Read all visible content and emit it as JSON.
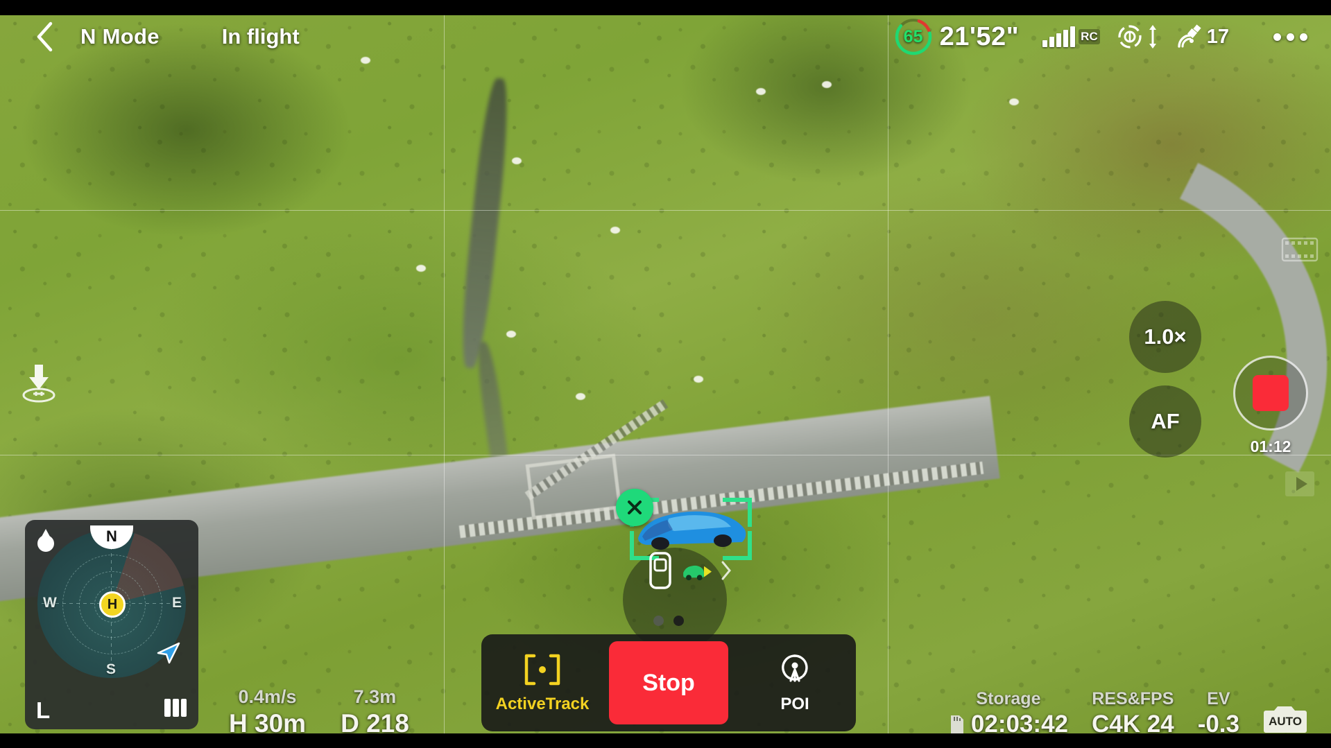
{
  "topbar": {
    "back_icon": "chevron-left-icon",
    "flight_mode": "N Mode",
    "flight_status": "In flight",
    "battery": {
      "percent_label": "65",
      "percent_value": 65,
      "reserve_color": "#e03a2f",
      "charge_color": "#1fd972"
    },
    "flight_time_remaining": "21'52\"",
    "signal": {
      "icon": "signal-bars-icon",
      "bars_filled": 5,
      "bars_total": 5,
      "label": "RC"
    },
    "obstacle_icon": "obstacle-sensing-icon",
    "vertical_icon": "up-down-arrow-icon",
    "satellite_icon": "satellite-icon",
    "satellite_count": "17",
    "menu_icon": "more-options-icon"
  },
  "overlays": {
    "land_icon": "land-aircraft-icon",
    "gallery_icon": "film-strip-icon",
    "play_icon": "play-icon",
    "grid_enabled": true
  },
  "camera_controls": {
    "zoom_label": "1.0×",
    "focus_label": "AF",
    "record_icon": "stop-record-square-icon",
    "record_elapsed": "01:12",
    "recording": true
  },
  "tracking": {
    "close_icon": "close-x-icon",
    "box_color": "#2fe08a",
    "target_options": [
      {
        "name": "car-top-view-icon",
        "selected": true
      },
      {
        "name": "car-direction-icon",
        "selected": false
      }
    ],
    "next_icon": "chevron-right-icon",
    "page_dots": [
      {
        "active": false
      },
      {
        "active": true
      }
    ]
  },
  "radar": {
    "north_label": "N",
    "west_label": "W",
    "east_label": "E",
    "south_label": "S",
    "home_label": "H",
    "aircraft_icon": "aircraft-arrow-icon",
    "pin_icon": "map-pin-icon",
    "left_label": "L",
    "layers_icon": "map-layers-icon"
  },
  "telemetry": {
    "left": [
      {
        "sub": "0.4m/s",
        "main": "H 30m"
      },
      {
        "sub": "7.3m",
        "main": "D 218"
      }
    ],
    "right": [
      {
        "sub": "Storage",
        "main": "02:03:42",
        "icon": "sd-card-icon"
      },
      {
        "sub": "RES&FPS",
        "main": "C4K 24",
        "icon": ""
      },
      {
        "sub": "EV",
        "main": "-0.3",
        "icon": ""
      }
    ],
    "auto_badge": {
      "icon": "camera-auto-icon",
      "label": "AUTO"
    }
  },
  "action_panel": {
    "activetrack": {
      "label": "ActiveTrack",
      "icon": "activetrack-bracket-icon",
      "color": "#f3d221"
    },
    "stop": {
      "label": "Stop",
      "color": "#fa2b38"
    },
    "poi": {
      "label": "POI",
      "icon": "poi-target-icon",
      "color": "#ffffff"
    }
  }
}
